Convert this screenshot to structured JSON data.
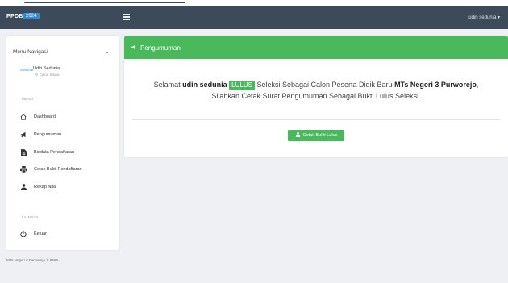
{
  "header": {
    "brand": "PPDB",
    "badge": "2024",
    "user_menu": "udin sedunia ▾"
  },
  "sidebar": {
    "menu_title": "Menu Navigasi",
    "user": {
      "tag": "Selamat",
      "name": "Udin Sedunia",
      "status": "Calon Siswa"
    },
    "section_main": "MENU",
    "items": [
      {
        "label": "Dashboard",
        "icon": "home-icon"
      },
      {
        "label": "Pengumuman",
        "icon": "bullhorn-icon"
      },
      {
        "label": "Biodata Pendaftaran",
        "icon": "file-icon"
      },
      {
        "label": "Cetak Bukti Pendaftaran",
        "icon": "print-icon"
      },
      {
        "label": "Rekap Nilai",
        "icon": "user-group-icon"
      }
    ],
    "section_other": "LAINNYA",
    "logout": {
      "label": "Keluar",
      "icon": "power-icon"
    }
  },
  "announcement": {
    "title": "Pengumuman",
    "greeting": "Selamat",
    "student_name": "udin sedunia",
    "status": "LULUS",
    "line1_rest": "Seleksi Sebagai Calon Peserta Didik Baru",
    "school": "MTs Negeri 3 Purworejo",
    "line2": "Silahkan Cetak Surat Pengumuman Sebagai Bukti Lulus Seleksi.",
    "button": "Cetak Bukti Lulus"
  },
  "footer": {
    "text": "MTs Negeri 3 Purworejo © 2023."
  },
  "colors": {
    "primary_green": "#4ab95b",
    "topbar": "#3c4a5a",
    "badge_blue": "#2f8bd8"
  }
}
